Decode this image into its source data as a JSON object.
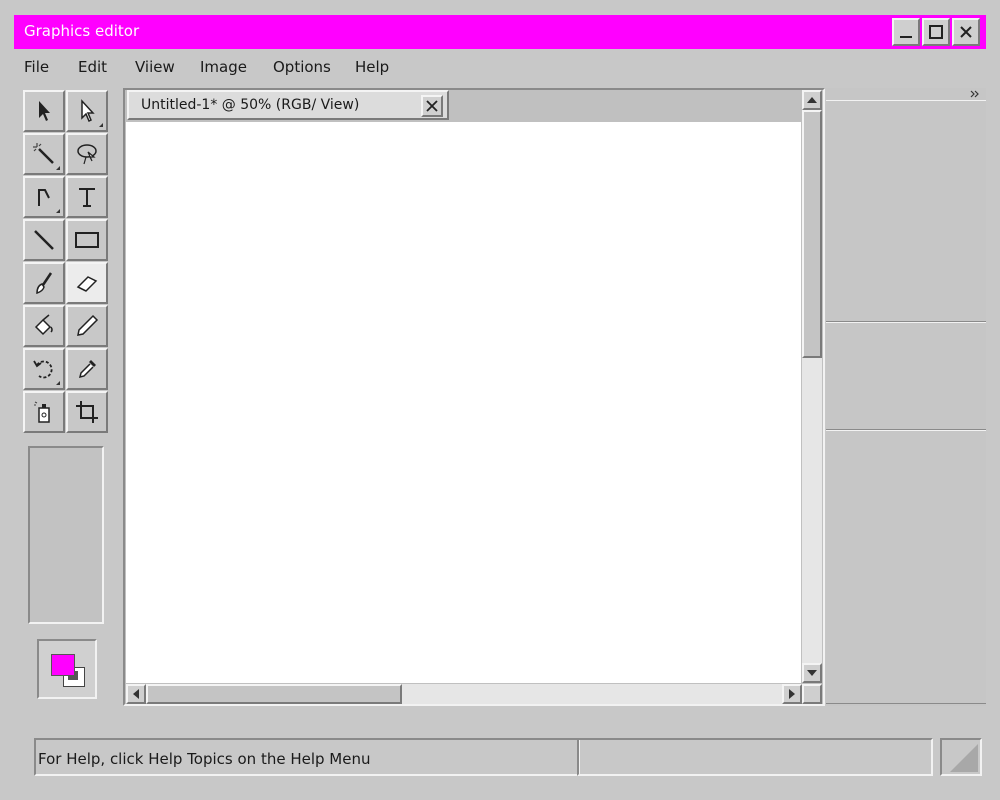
{
  "window": {
    "title": "Graphics editor",
    "controls": [
      "minimize",
      "maximize",
      "close"
    ]
  },
  "menu": {
    "items": [
      {
        "id": "file",
        "label": "File"
      },
      {
        "id": "edit",
        "label": "Edit"
      },
      {
        "id": "view",
        "label": "Viiew"
      },
      {
        "id": "image",
        "label": "Image"
      },
      {
        "id": "options",
        "label": "Options"
      },
      {
        "id": "help",
        "label": "Help"
      }
    ]
  },
  "tools": [
    {
      "name": "selection-arrow",
      "icon": "arrow-icon"
    },
    {
      "name": "direct-selection",
      "icon": "hollow-arrow-icon"
    },
    {
      "name": "magic-wand",
      "icon": "magic-wand-icon"
    },
    {
      "name": "lasso",
      "icon": "lasso-icon"
    },
    {
      "name": "pen",
      "icon": "pen-path-icon"
    },
    {
      "name": "text",
      "icon": "text-icon"
    },
    {
      "name": "line",
      "icon": "line-icon"
    },
    {
      "name": "rectangle",
      "icon": "rectangle-icon"
    },
    {
      "name": "brush",
      "icon": "brush-icon"
    },
    {
      "name": "eraser",
      "icon": "eraser-icon",
      "active": true
    },
    {
      "name": "paint-bucket",
      "icon": "paint-bucket-icon"
    },
    {
      "name": "pencil",
      "icon": "pencil-icon"
    },
    {
      "name": "rotate",
      "icon": "rotate-icon"
    },
    {
      "name": "eyedropper",
      "icon": "eyedropper-icon"
    },
    {
      "name": "spray",
      "icon": "spray-can-icon"
    },
    {
      "name": "crop",
      "icon": "crop-icon"
    }
  ],
  "colors": {
    "titlebar": "#ff00ff",
    "foreground": "#ff00ff",
    "background": "#ffffff"
  },
  "document": {
    "tab_title": "Untitled-1* @ 50% (RGB/ View)"
  },
  "status": {
    "help_text": "For Help, click Help Topics on the Help Menu"
  }
}
